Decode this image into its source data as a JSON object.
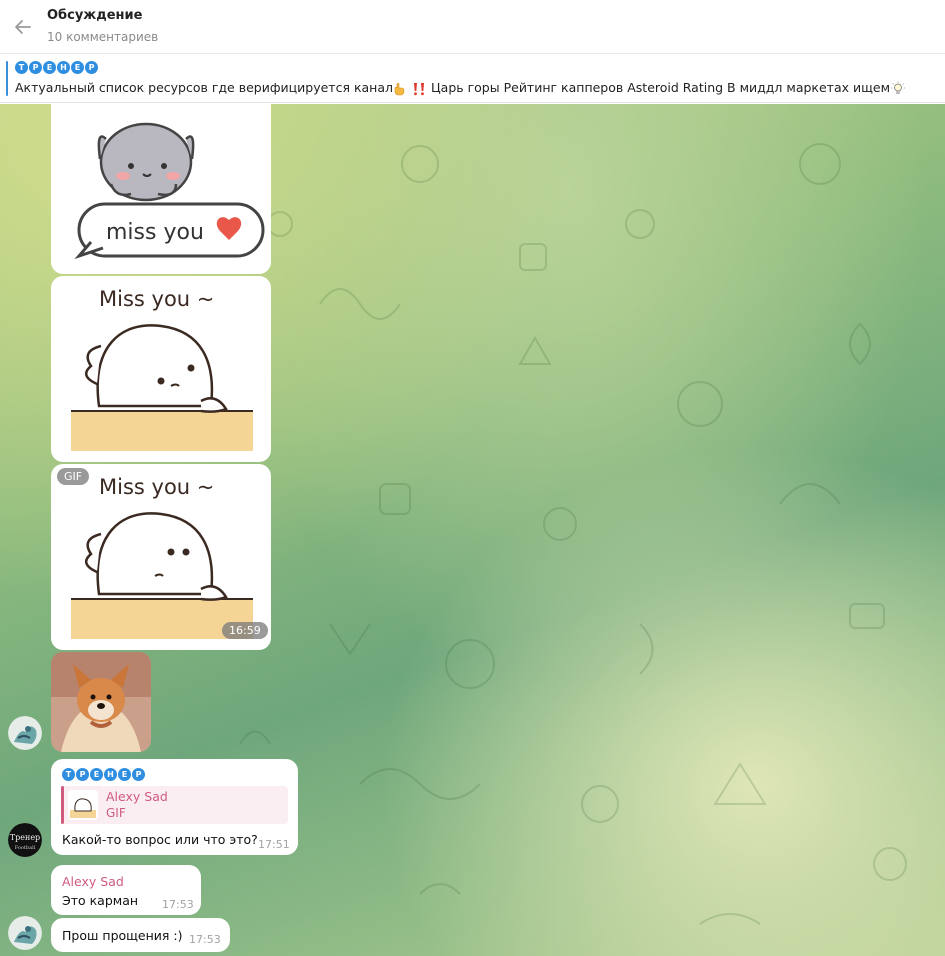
{
  "header": {
    "title": "Обсуждение",
    "subtitle": "10 комментариев"
  },
  "pinned": {
    "badge_letters": [
      "Т",
      "Р",
      "Е",
      "Н",
      "Е",
      "Р"
    ],
    "text": "Актуальный список ресурсов где верифицируется канал",
    "text_tail": "Царь горы Рейтинг капперов Asteroid Rating В миддл маркетах ищем"
  },
  "stickers": [
    {
      "caption": "miss you"
    },
    {
      "caption": "Miss you ~"
    },
    {
      "caption": "Miss you ~",
      "tag": "GIF",
      "time": "16:59"
    }
  ],
  "messages": [
    {
      "badge_letters": [
        "Т",
        "Р",
        "Е",
        "Н",
        "Е",
        "Р"
      ],
      "reply_name": "Alexy Sad",
      "reply_type": "GIF",
      "text": "Какой-то вопрос или что это?",
      "time": "17:51",
      "avatar_text_top": "Тренер",
      "avatar_text_bottom": "Football"
    },
    {
      "name": "Alexy Sad",
      "text": "Это карман",
      "time": "17:53"
    },
    {
      "text": "Прош прощения :)",
      "time": "17:53"
    }
  ],
  "colors": {
    "accent": "#2f8ee0",
    "name_pink": "#d05b7f"
  }
}
